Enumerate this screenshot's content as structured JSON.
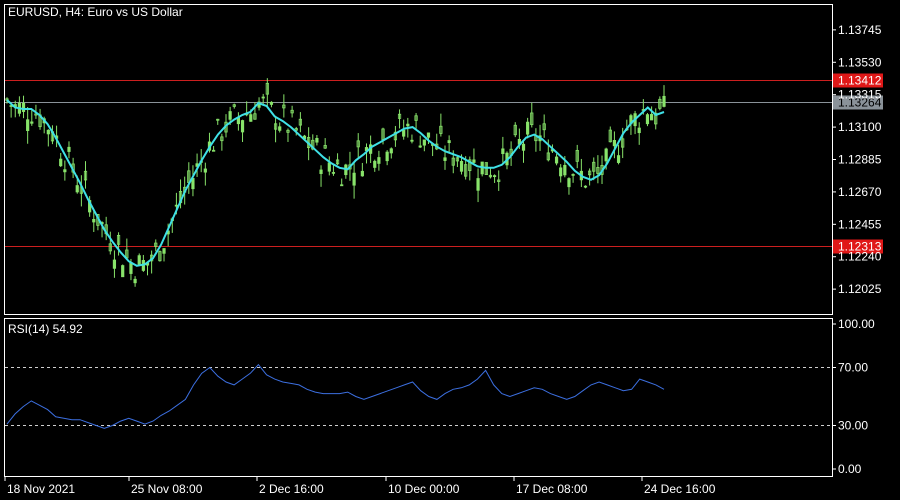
{
  "header": {
    "symbol": "EURUSD",
    "timeframe": "H4",
    "description": "Euro vs US Dollar"
  },
  "indicator_label": "RSI(14) 54.92",
  "colors": {
    "background": "#000000",
    "frame": "#ffffff",
    "candle": "#88e36a",
    "ma": "#3fe0e6",
    "rsi": "#3c6fe0",
    "hline": "#cc1f1f",
    "price_tag": "#8a9299",
    "level_tag": "#e01818"
  },
  "chart_data": [
    {
      "type": "candlestick",
      "title": "EURUSD, H4:  Euro vs US Dollar",
      "ylim": [
        1.1186,
        1.1391
      ],
      "yticks": [
        "1.13745",
        "1.13530",
        "1.13315",
        "1.13100",
        "1.12885",
        "1.12670",
        "1.12455",
        "1.12240",
        "1.12025"
      ],
      "current_price": "1.13264",
      "levels": [
        {
          "value": 1.13412,
          "label": "1.13412"
        },
        {
          "value": 1.12313,
          "label": "1.12313"
        }
      ],
      "ma_series": [
        1.1328,
        1.1323,
        1.1322,
        1.1322,
        1.1318,
        1.1312,
        1.1303,
        1.1293,
        1.1283,
        1.1273,
        1.1262,
        1.1252,
        1.1242,
        1.1234,
        1.1227,
        1.1221,
        1.1218,
        1.1219,
        1.1223,
        1.1232,
        1.1244,
        1.1256,
        1.1268,
        1.1278,
        1.1288,
        1.1297,
        1.1305,
        1.1311,
        1.1315,
        1.1318,
        1.132,
        1.1326,
        1.1324,
        1.1317,
        1.1314,
        1.131,
        1.1305,
        1.13,
        1.1295,
        1.129,
        1.1286,
        1.1283,
        1.1282,
        1.1288,
        1.1292,
        1.1297,
        1.13,
        1.1303,
        1.1306,
        1.1309,
        1.131,
        1.1306,
        1.1301,
        1.1297,
        1.1294,
        1.1292,
        1.129,
        1.1287,
        1.1284,
        1.1283,
        1.1283,
        1.1285,
        1.129,
        1.1297,
        1.1303,
        1.1305,
        1.1302,
        1.1297,
        1.1292,
        1.1287,
        1.1281,
        1.1277,
        1.1275,
        1.1278,
        1.1286,
        1.1296,
        1.1306,
        1.1313,
        1.1318,
        1.1323,
        1.1318,
        1.132
      ]
    },
    {
      "type": "line",
      "title": "RSI(14) 54.92",
      "ylim": [
        0,
        100
      ],
      "yticks": [
        "100.00",
        "70.00",
        "30.00",
        "0.00"
      ],
      "levels": [
        70,
        30
      ],
      "series": [
        {
          "values": [
            31,
            38,
            43,
            47,
            44,
            41,
            36,
            35,
            34,
            34,
            32,
            30,
            28,
            30,
            33,
            35,
            33,
            31,
            33,
            37,
            40,
            44,
            48,
            58,
            66,
            70,
            64,
            60,
            58,
            62,
            66,
            72,
            65,
            62,
            60,
            59,
            58,
            55,
            53,
            52,
            52,
            52,
            53,
            50,
            48,
            50,
            52,
            54,
            56,
            58,
            60,
            54,
            50,
            48,
            52,
            55,
            56,
            58,
            62,
            68,
            58,
            52,
            50,
            52,
            54,
            56,
            55,
            52,
            50,
            48,
            50,
            54,
            58,
            60,
            58,
            56,
            54,
            55,
            62,
            60,
            58,
            55
          ]
        }
      ]
    }
  ],
  "x_axis_labels": [
    "18 Nov 2021",
    "25 Nov 08:00",
    "2 Dec 16:00",
    "10 Dec 00:00",
    "17 Dec 08:00",
    "24 Dec 16:00"
  ]
}
